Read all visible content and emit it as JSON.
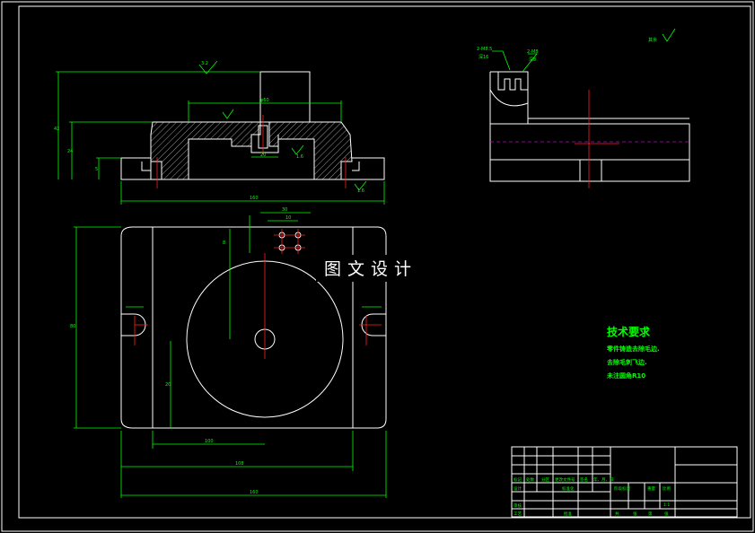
{
  "watermark": {
    "text": "图文设计"
  },
  "technical_requirements": {
    "title": "技术要求",
    "lines": [
      "零件铸造去除毛边.",
      "去除毛刺飞边.",
      "未注圆角R10"
    ]
  },
  "section_view": {
    "dims": {
      "overall_width": "160",
      "top_boss": "φ60",
      "total_height": "42",
      "step_height": "24",
      "base_height": "5",
      "slot_width": "20",
      "surface_finish": "1.6",
      "top_finish": "3.2"
    }
  },
  "side_view": {
    "callouts": {
      "thread": "2-M8.5",
      "depth": "深16",
      "pin": "2-M8",
      "pin_depth": "深8"
    },
    "roughness": "其余"
  },
  "plan_view": {
    "dims": {
      "hole_spacing": "30",
      "hole_offset": "10",
      "slot_width": "8",
      "height_inner": "80",
      "height_outer": "20",
      "half_width": "100",
      "width_inner": "108",
      "width_outer": "160"
    }
  },
  "title_block": {
    "labels": [
      "标记",
      "处数",
      "分区",
      "更改文件号",
      "签名",
      "年、月、日",
      "设计",
      "标准化",
      "审核",
      "工艺",
      "批准",
      "阶段标记",
      "重量",
      "比例",
      "1:1",
      "共",
      "张",
      "第",
      "张"
    ]
  }
}
